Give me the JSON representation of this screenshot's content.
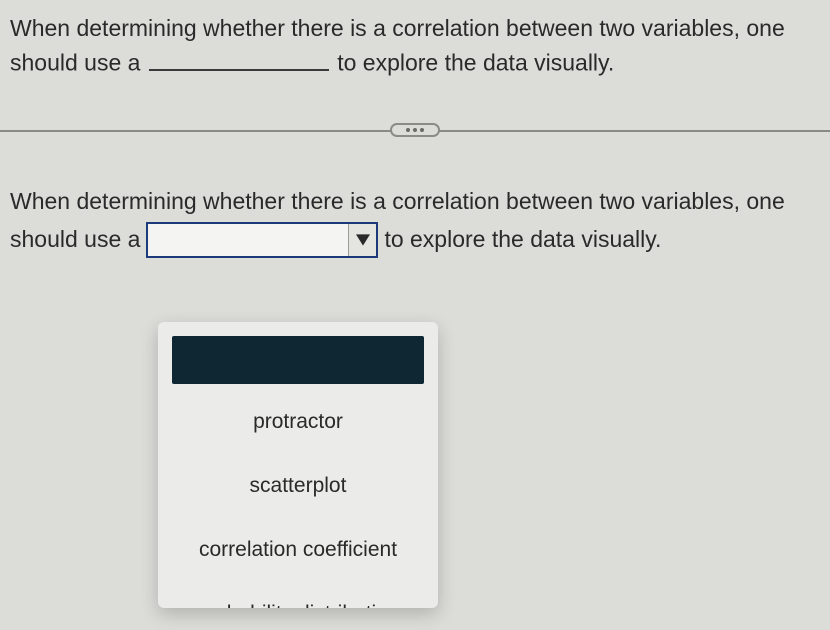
{
  "question": {
    "prefix": "When determining whether there is a correlation between two variables, one should use a",
    "suffix": "to explore the data visually.",
    "line1_full": "When determining whether there is a correlation between two variables, one",
    "line2_pre": "should use a",
    "line2_post": "to explore the data visually."
  },
  "dropdown": {
    "selected": "",
    "options": [
      "",
      "protractor",
      "scatterplot",
      "correlation coefficient",
      "probability distribution"
    ]
  }
}
